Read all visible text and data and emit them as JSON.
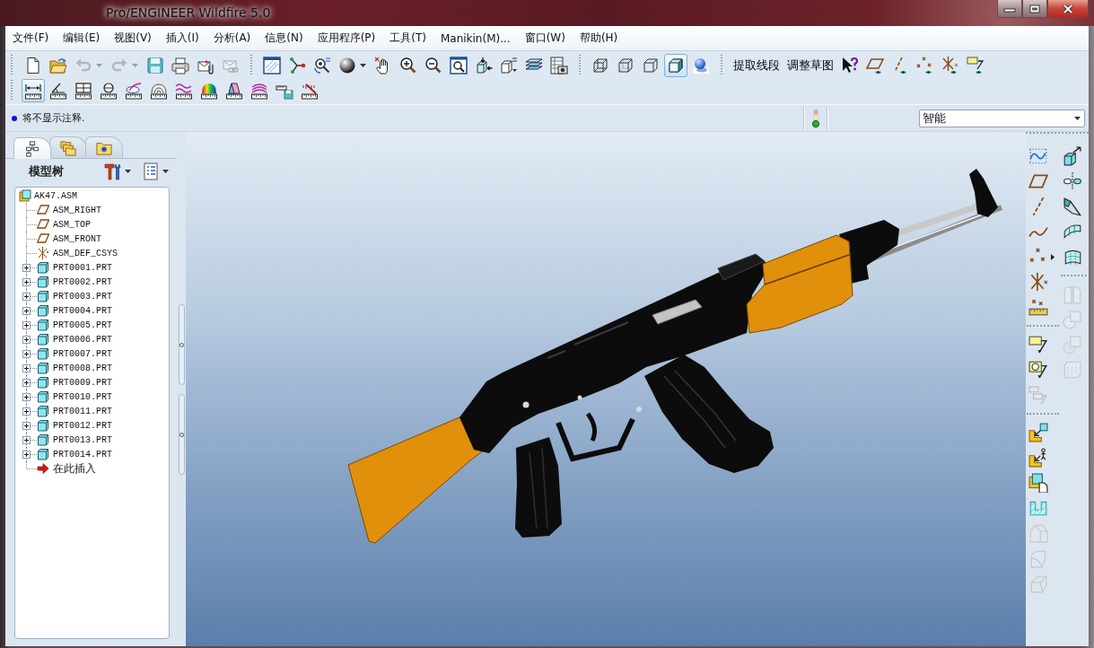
{
  "window": {
    "title": "Pro/ENGINEER Wildfire 5.0"
  },
  "menu_bar": [
    "文件(F)",
    "编辑(E)",
    "视图(V)",
    "插入(I)",
    "分析(A)",
    "信息(N)",
    "应用程序(P)",
    "工具(T)",
    "Manikin(M)...",
    "窗口(W)",
    "帮助(H)"
  ],
  "toolbar": {
    "file_tools": [
      {
        "disabled": false
      },
      {
        "disabled": false
      },
      {
        "disabled": true
      },
      {
        "disabled": true
      },
      {
        "disabled": false
      },
      {
        "disabled": false
      },
      {
        "disabled": false
      },
      {
        "disabled": true
      }
    ],
    "display_styles": [
      {
        "selected": false
      },
      {
        "selected": false
      },
      {
        "selected": false
      },
      {
        "selected": true
      }
    ],
    "text_buttons": [
      "提取线段",
      "调整草图"
    ],
    "analysis_tools": [
      {
        "selected": true
      },
      {
        "selected": false
      },
      {
        "selected": false
      },
      {
        "selected": false
      },
      {
        "selected": false
      },
      {
        "selected": false
      },
      {
        "selected": false
      },
      {
        "selected": false
      },
      {
        "selected": false
      },
      {
        "selected": false
      },
      {
        "selected": false
      },
      {
        "selected": false
      }
    ]
  },
  "message_area": {
    "message": "将不显示注释.",
    "filter": "智能"
  },
  "model_tree": {
    "tabs": [
      {
        "selected": true
      },
      {
        "selected": false
      },
      {
        "selected": false
      }
    ],
    "title": "模型树",
    "root": {
      "label": "AK47.ASM",
      "children": [
        {
          "kind": "plane",
          "label": "ASM_RIGHT"
        },
        {
          "kind": "plane",
          "label": "ASM_TOP"
        },
        {
          "kind": "plane",
          "label": "ASM_FRONT"
        },
        {
          "kind": "csys",
          "label": "ASM_DEF_CSYS"
        },
        {
          "kind": "part",
          "label": "PRT0001.PRT",
          "expanded": false
        },
        {
          "kind": "part",
          "label": "PRT0002.PRT",
          "expanded": false
        },
        {
          "kind": "part",
          "label": "PRT0003.PRT",
          "expanded": false
        },
        {
          "kind": "part",
          "label": "PRT0004.PRT",
          "expanded": false
        },
        {
          "kind": "part",
          "label": "PRT0005.PRT",
          "expanded": false
        },
        {
          "kind": "part",
          "label": "PRT0006.PRT",
          "expanded": false
        },
        {
          "kind": "part",
          "label": "PRT0007.PRT",
          "expanded": false
        },
        {
          "kind": "part",
          "label": "PRT0008.PRT",
          "expanded": false
        },
        {
          "kind": "part",
          "label": "PRT0009.PRT",
          "expanded": false
        },
        {
          "kind": "part",
          "label": "PRT0010.PRT",
          "expanded": false
        },
        {
          "kind": "part",
          "label": "PRT0011.PRT",
          "expanded": false
        },
        {
          "kind": "part",
          "label": "PRT0012.PRT",
          "expanded": false
        },
        {
          "kind": "part",
          "label": "PRT0013.PRT",
          "expanded": false
        },
        {
          "kind": "part",
          "label": "PRT0014.PRT",
          "expanded": false
        },
        {
          "kind": "insert",
          "label": "在此插入"
        }
      ]
    }
  },
  "right_toolbar": {
    "annotation_tools": [
      {
        "disabled": false
      },
      {
        "disabled": false
      },
      {
        "disabled": true
      }
    ],
    "component_tools": [
      {
        "disabled": false
      },
      {
        "disabled": false
      },
      {
        "disabled": false
      },
      {
        "disabled": false
      },
      {
        "disabled": true
      },
      {
        "disabled": true
      },
      {
        "disabled": true
      }
    ],
    "editing_tools": [
      {
        "disabled": true
      },
      {
        "disabled": true
      },
      {
        "disabled": true
      },
      {
        "disabled": true
      }
    ]
  }
}
